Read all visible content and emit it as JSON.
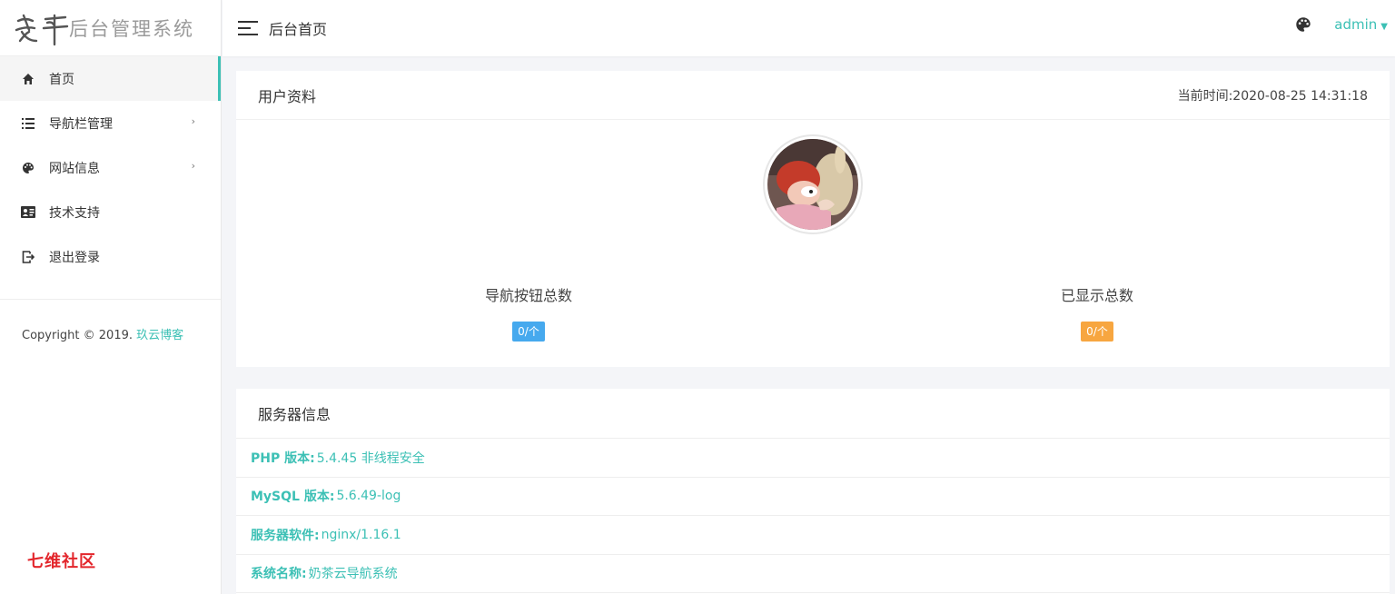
{
  "brand": {
    "logo_mark": "kao-wu-logo",
    "logo_text": "后台管理系统"
  },
  "sidebar": {
    "items": [
      {
        "label": "首页",
        "icon": "home-icon",
        "active": true,
        "has_submenu": false
      },
      {
        "label": "导航栏管理",
        "icon": "list-icon",
        "active": false,
        "has_submenu": true
      },
      {
        "label": "网站信息",
        "icon": "palette-icon",
        "active": false,
        "has_submenu": true
      },
      {
        "label": "技术支持",
        "icon": "id-card-icon",
        "active": false,
        "has_submenu": false
      },
      {
        "label": "退出登录",
        "icon": "logout-icon",
        "active": false,
        "has_submenu": false
      }
    ],
    "copyright_prefix": "Copyright © 2019. ",
    "copyright_link": "玖云博客"
  },
  "header": {
    "title": "后台首页",
    "user": "admin"
  },
  "profile_card": {
    "title": "用户资料",
    "time_label": "当前时间:",
    "time_value": "2020-08-25 14:31:18",
    "stats": [
      {
        "label": "导航按钮总数",
        "value": "0/个",
        "color": "#46a9ee"
      },
      {
        "label": "已显示总数",
        "value": "0/个",
        "color": "#f7a640"
      }
    ]
  },
  "server_card": {
    "title": "服务器信息",
    "rows": [
      {
        "key": "PHP 版本:",
        "value": "5.4.45 非线程安全"
      },
      {
        "key": "MySQL 版本:",
        "value": "5.6.49-log"
      },
      {
        "key": "服务器软件:",
        "value": "nginx/1.16.1"
      },
      {
        "key": "系统名称:",
        "value": "奶茶云导航系统"
      }
    ]
  },
  "watermark": "七维社区",
  "colors": {
    "accent": "#3cc0b5",
    "badge_blue": "#46a9ee",
    "badge_orange": "#f7a640"
  }
}
